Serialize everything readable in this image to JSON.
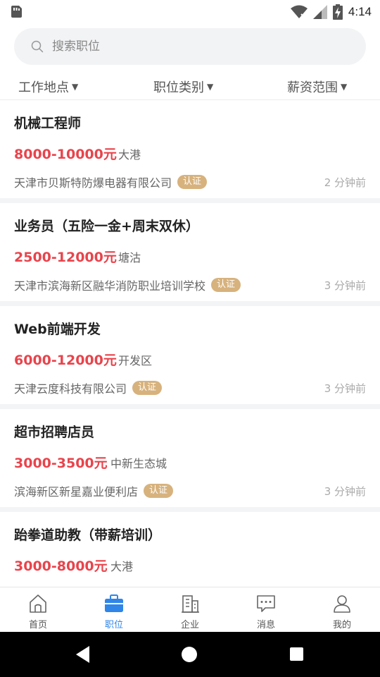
{
  "status_bar": {
    "time": "4:14"
  },
  "search": {
    "placeholder": "搜索职位"
  },
  "filters": [
    {
      "label": "工作地点"
    },
    {
      "label": "职位类别"
    },
    {
      "label": "薪资范围"
    }
  ],
  "jobs": [
    {
      "title": "机械工程师",
      "salary": "8000-10000元",
      "area": "大港",
      "company": "天津市贝斯特防爆电器有限公司",
      "badge": "认证",
      "time": "2 分钟前"
    },
    {
      "title": "业务员（五险一金+周末双休）",
      "salary": "2500-12000元",
      "area": "塘沽",
      "company": "天津市滨海新区融华消防职业培训学校",
      "badge": "认证",
      "time": "3 分钟前"
    },
    {
      "title": "Web前端开发",
      "salary": "6000-12000元",
      "area": "开发区",
      "company": "天津云度科技有限公司",
      "badge": "认证",
      "time": "3 分钟前"
    },
    {
      "title": "超市招聘店员",
      "salary": "3000-3500元",
      "area": "中新生态城",
      "company": "滨海新区新星嘉业便利店",
      "badge": "认证",
      "time": "3 分钟前"
    },
    {
      "title": "跆拳道助教（带薪培训）",
      "salary": "3000-8000元",
      "area": "大港",
      "company": "",
      "badge": "",
      "time": ""
    }
  ],
  "tabs": [
    {
      "label": "首页",
      "icon": "home-icon"
    },
    {
      "label": "职位",
      "icon": "briefcase-icon",
      "active": true
    },
    {
      "label": "企业",
      "icon": "building-icon"
    },
    {
      "label": "消息",
      "icon": "message-icon"
    },
    {
      "label": "我的",
      "icon": "user-icon"
    }
  ],
  "colors": {
    "accent": "#2f86e8",
    "salary": "#e8444c",
    "badge": "#d7b27d"
  }
}
